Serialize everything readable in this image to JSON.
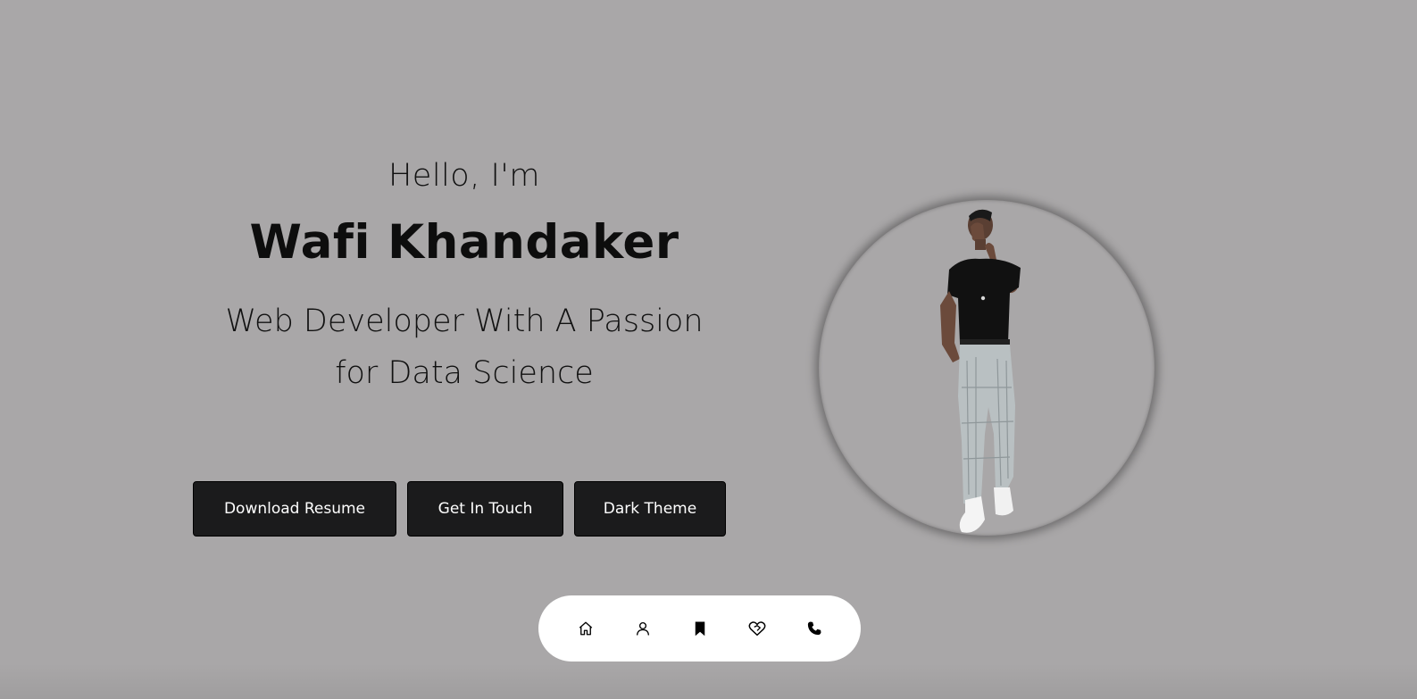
{
  "hero": {
    "greeting": "Hello, I'm",
    "name": "Wafi Khandaker",
    "tagline": "Web Developer With A Passion for Data Science"
  },
  "buttons": {
    "download_resume": "Download Resume",
    "get_in_touch": "Get In Touch",
    "dark_theme": "Dark Theme"
  },
  "nav": {
    "items": [
      {
        "icon": "home-icon"
      },
      {
        "icon": "user-icon"
      },
      {
        "icon": "bookmark-icon"
      },
      {
        "icon": "heart-handshake-icon"
      },
      {
        "icon": "phone-icon"
      }
    ]
  },
  "colors": {
    "background": "#a9a7a8",
    "button_bg": "#1b1b1c",
    "button_text": "#ffffff",
    "nav_bg": "#ffffff",
    "text": "#111111"
  }
}
